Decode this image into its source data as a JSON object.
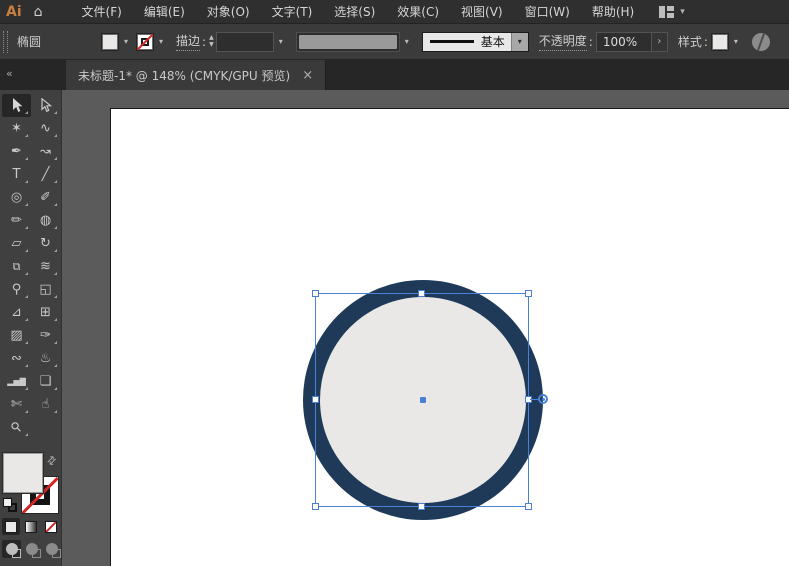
{
  "menu_bar": {
    "logo_text": "Ai",
    "items": [
      {
        "label": "文件(F)"
      },
      {
        "label": "编辑(E)"
      },
      {
        "label": "对象(O)"
      },
      {
        "label": "文字(T)"
      },
      {
        "label": "选择(S)"
      },
      {
        "label": "效果(C)"
      },
      {
        "label": "视图(V)"
      },
      {
        "label": "窗口(W)"
      },
      {
        "label": "帮助(H)"
      }
    ]
  },
  "control_bar": {
    "context_label": "椭圆",
    "stroke_label": "描边",
    "colon": ":",
    "stroke_weight_value": "",
    "stroke_style_value": "基本",
    "opacity_label": "不透明度",
    "opacity_value": "100%",
    "more_arrow": "›",
    "style_label": "样式",
    "stepper_up": "▲",
    "stepper_down": "▼",
    "chevron": "▾"
  },
  "tab_bar": {
    "collapse_icon": "«",
    "active_tab": {
      "title": "未标题-1* @ 148% (CMYK/GPU 预览)",
      "close": "×"
    }
  },
  "toolbar": {
    "tools": [
      {
        "name": "selection",
        "glyph": "",
        "active": true
      },
      {
        "name": "direct-selection",
        "glyph": ""
      },
      {
        "name": "magic-wand",
        "glyph": "✶"
      },
      {
        "name": "lasso",
        "glyph": "∿"
      },
      {
        "name": "pen",
        "glyph": "✒"
      },
      {
        "name": "curvature",
        "glyph": "↝"
      },
      {
        "name": "type",
        "glyph": "T"
      },
      {
        "name": "line-segment",
        "glyph": "╱"
      },
      {
        "name": "ellipse",
        "glyph": "◎"
      },
      {
        "name": "paintbrush",
        "glyph": "✐"
      },
      {
        "name": "pencil",
        "glyph": "✏"
      },
      {
        "name": "shaper",
        "glyph": "◍"
      },
      {
        "name": "eraser",
        "glyph": "▱"
      },
      {
        "name": "rotate",
        "glyph": "↻"
      },
      {
        "name": "scale",
        "glyph": "⧉"
      },
      {
        "name": "width",
        "glyph": "≋"
      },
      {
        "name": "puppet-warp",
        "glyph": "⚲"
      },
      {
        "name": "shape-builder",
        "glyph": "◱"
      },
      {
        "name": "perspective-grid",
        "glyph": "⊿"
      },
      {
        "name": "mesh",
        "glyph": "⊞"
      },
      {
        "name": "gradient",
        "glyph": "▨"
      },
      {
        "name": "eyedropper",
        "glyph": "✑"
      },
      {
        "name": "blend",
        "glyph": "∾"
      },
      {
        "name": "symbol-sprayer",
        "glyph": "♨"
      },
      {
        "name": "column-graph",
        "glyph": "▂▅▇"
      },
      {
        "name": "artboard",
        "glyph": "❏"
      },
      {
        "name": "slice",
        "glyph": "✄"
      },
      {
        "name": "hand",
        "glyph": "☝"
      },
      {
        "name": "zoom",
        "glyph": "⚲"
      }
    ]
  },
  "canvas": {
    "selected_shape": {
      "type": "ellipse",
      "fill_color": "#e9e8e6",
      "stroke_color": "#1e3a58"
    }
  },
  "colors": {
    "accent_orange": "#c87e3e",
    "selection_blue": "#4a80d8",
    "none_red": "#cf2727",
    "ui_dark": "#2f2f2f",
    "pasteboard": "#5b5b5b"
  }
}
